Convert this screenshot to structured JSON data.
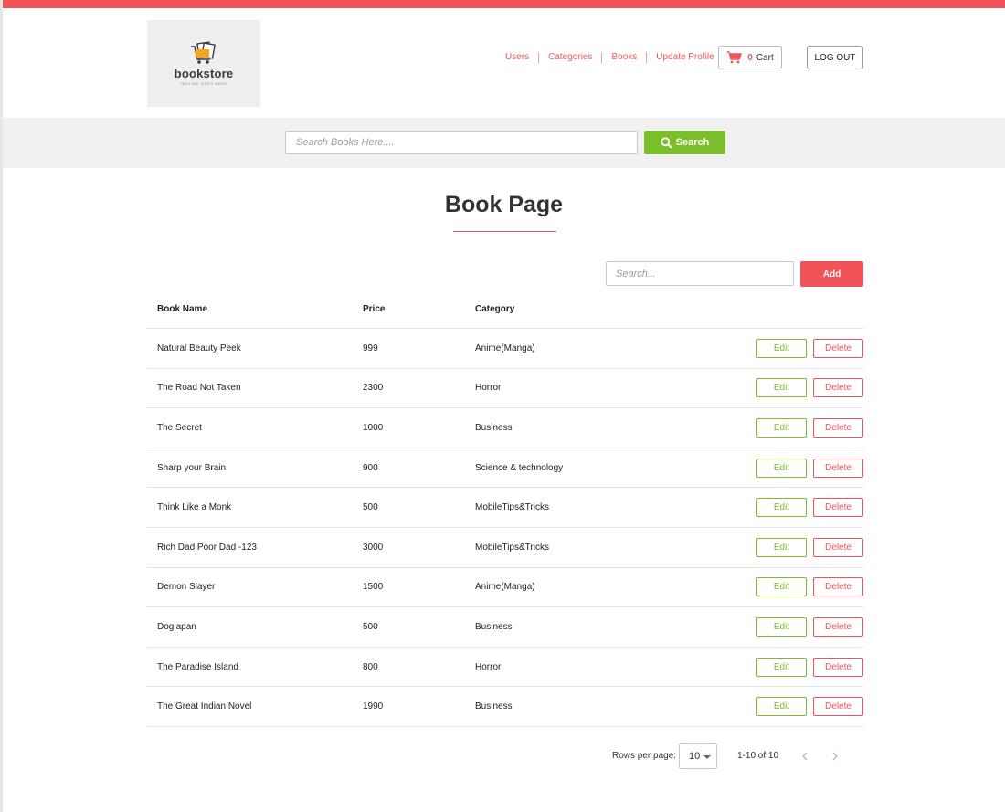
{
  "logo": {
    "name": "bookstore",
    "tagline": "TAGLINE GOES HERE"
  },
  "nav": {
    "items": [
      {
        "label": "Users"
      },
      {
        "label": "Categories"
      },
      {
        "label": "Books"
      },
      {
        "label": "Update Profile"
      }
    ],
    "cart_count": "0",
    "cart_label": "Cart",
    "logout_label": "LOG OUT"
  },
  "search": {
    "placeholder": "Search Books Here....",
    "button_label": "Search"
  },
  "page": {
    "title": "Book Page"
  },
  "table_controls": {
    "search_placeholder": "Search...",
    "add_label": "Add"
  },
  "table": {
    "headers": {
      "name": "Book Name",
      "price": "Price",
      "category": "Category"
    },
    "edit_label": "Edit",
    "delete_label": "Delete",
    "rows": [
      {
        "name": "Natural Beauty Peek",
        "price": "999",
        "category": "Anime(Manga)"
      },
      {
        "name": "The Road Not Taken",
        "price": "2300",
        "category": "Horror"
      },
      {
        "name": "The Secret",
        "price": "1000",
        "category": "Business"
      },
      {
        "name": "Sharp your Brain",
        "price": "900",
        "category": "Science & technology"
      },
      {
        "name": "Think Like a Monk",
        "price": "500",
        "category": "MobileTips&Tricks"
      },
      {
        "name": "Rich Dad Poor Dad -123",
        "price": "3000",
        "category": "MobileTips&Tricks"
      },
      {
        "name": "Demon Slayer",
        "price": "1500",
        "category": "Anime(Manga)"
      },
      {
        "name": "Doglapan",
        "price": "500",
        "category": "Business"
      },
      {
        "name": "The Paradise Island",
        "price": "800",
        "category": "Horror"
      },
      {
        "name": "The Great Indian Novel",
        "price": "1990",
        "category": "Business"
      }
    ]
  },
  "pagination": {
    "rows_per_page_label": "Rows per page:",
    "rows_per_page": "10",
    "range": "1-10 of 10"
  },
  "colors": {
    "accent": "#f05459",
    "success": "#7bbd2b",
    "band": "#f1f1f1"
  },
  "icons": {
    "cart": "shopping-cart-icon",
    "search": "magnifier-icon",
    "prev": "chevron-left-icon",
    "next": "chevron-right-icon"
  }
}
